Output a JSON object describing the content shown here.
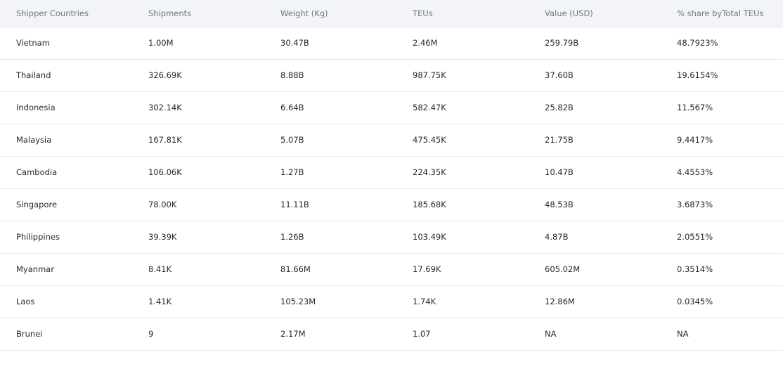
{
  "table": {
    "headers": [
      "Shipper Countries",
      "Shipments",
      "Weight (Kg)",
      "TEUs",
      "Value (USD)",
      "% share byTotal TEUs"
    ],
    "rows": [
      [
        "Vietnam",
        "1.00M",
        "30.47B",
        "2.46M",
        "259.79B",
        "48.7923%"
      ],
      [
        "Thailand",
        "326.69K",
        "8.88B",
        "987.75K",
        "37.60B",
        "19.6154%"
      ],
      [
        "Indonesia",
        "302.14K",
        "6.64B",
        "582.47K",
        "25.82B",
        "11.567%"
      ],
      [
        "Malaysia",
        "167.81K",
        "5.07B",
        "475.45K",
        "21.75B",
        "9.4417%"
      ],
      [
        "Cambodia",
        "106.06K",
        "1.27B",
        "224.35K",
        "10.47B",
        "4.4553%"
      ],
      [
        "Singapore",
        "78.00K",
        "11.11B",
        "185.68K",
        "48.53B",
        "3.6873%"
      ],
      [
        "Philippines",
        "39.39K",
        "1.26B",
        "103.49K",
        "4.87B",
        "2.0551%"
      ],
      [
        "Myanmar",
        "8.41K",
        "81.66M",
        "17.69K",
        "605.02M",
        "0.3514%"
      ],
      [
        "Laos",
        "1.41K",
        "105.23M",
        "1.74K",
        "12.86M",
        "0.0345%"
      ],
      [
        "Brunei",
        "9",
        "2.17M",
        "1.07",
        "NA",
        "NA"
      ]
    ]
  }
}
